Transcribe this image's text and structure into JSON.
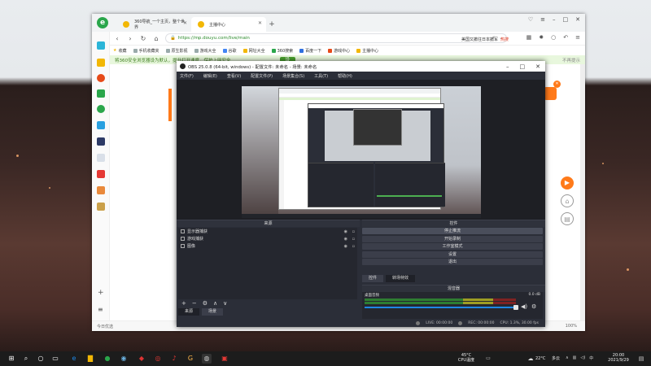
{
  "browser": {
    "tabs": [
      {
        "label": "360导航_一个主页，整个世界",
        "active": false
      },
      {
        "label": "主播中心",
        "active": true
      }
    ],
    "new_tab": "+",
    "url": "https://mp.douyu.com/live/main",
    "search_text": "美国又撤往日本撤军",
    "search_badge": "热搜",
    "bookmarks": [
      "收藏",
      "手机收藏夹",
      "原生影视",
      "游戏大全",
      "谷歌",
      "网址大全",
      "360搜索",
      "百度一下",
      "游戏中心",
      "主播中心"
    ],
    "notice_text": "将360安全浏览器设为默认，提升打开速度，保护上网安全",
    "notice_button": "设",
    "notice_close": "不再提示",
    "status_left": "今日优选",
    "zoom": "100%"
  },
  "obs": {
    "title": "OBS 25.0.8 (64-bit, windows) - 配置文件: 未命名 - 场景: 未命名",
    "menu": [
      "文件(F)",
      "编辑(E)",
      "查看(V)",
      "配置文件(P)",
      "场景集合(S)",
      "工具(T)",
      "帮助(H)"
    ],
    "docks": {
      "scenes": "来源",
      "controls": "控件"
    },
    "sources": [
      {
        "name": "显示器捕获"
      },
      {
        "name": "游戏捕获"
      },
      {
        "name": "图像"
      }
    ],
    "source_tools": [
      "+",
      "−",
      "⚙",
      "∧",
      "∨"
    ],
    "source_tabs": [
      "来源",
      "场景"
    ],
    "controls": [
      "停止推流",
      "开始录制",
      "工作室模式",
      "设置",
      "退出"
    ],
    "control_tabs": [
      "控件",
      "转场特效"
    ],
    "mixer_title": "混音器",
    "mixer_channel": "桌面音频",
    "mixer_db": "0.0 dB",
    "mixer_level": 0.65,
    "status": [
      "LIVE: 00:00:00",
      "REC: 00:00:00",
      "CPU: 1.3%, 30.00 fps"
    ]
  },
  "taskbar": {
    "weather_temp": "45°C",
    "weather_label": "CPU温度",
    "temp": "22°C",
    "weather": "多云",
    "time": "20:00",
    "date": "2021/9/29"
  },
  "colors": {
    "accent_orange": "#ff7a1a",
    "green": "#2aa64b",
    "obs_bg": "#2b2e38"
  }
}
